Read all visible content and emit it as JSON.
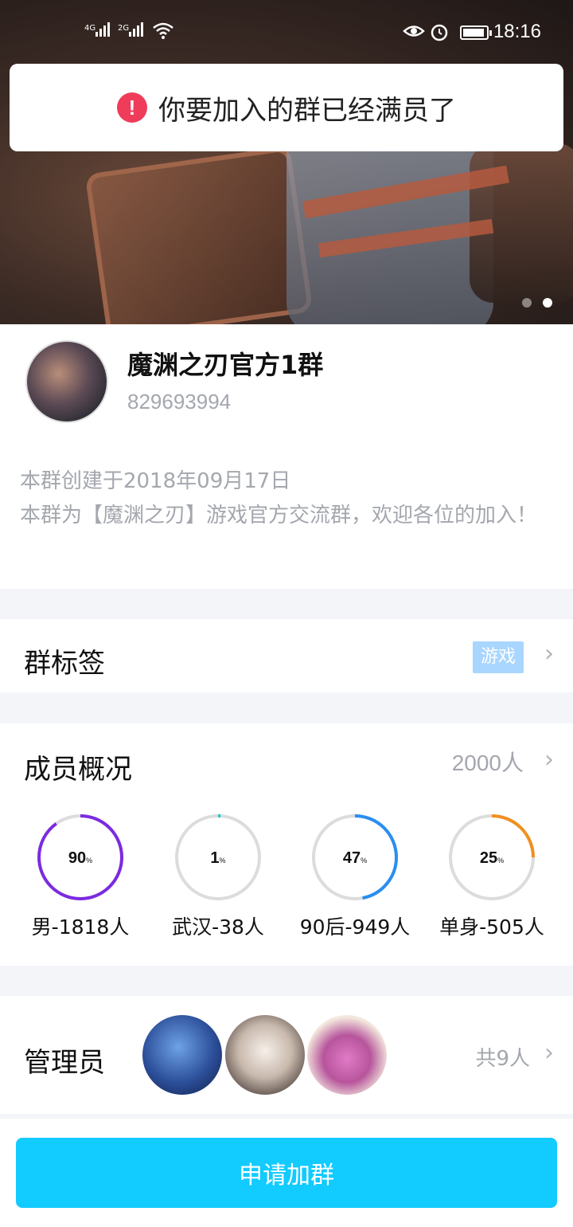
{
  "status_bar": {
    "sig1": "4G",
    "sig2": "2G",
    "time": "18:16",
    "icons": [
      "eye-icon",
      "alarm-icon",
      "wifi-icon",
      "battery-icon"
    ]
  },
  "toast": {
    "icon": "alert-icon",
    "message": "你要加入的群已经满员了"
  },
  "banner": {
    "slides": 2,
    "active_slide": 2
  },
  "group": {
    "name": "魔渊之刃官方1群",
    "id": "829693994",
    "created": "本群创建于2018年09月17日",
    "description": "本群为【魔渊之刃】游戏官方交流群，欢迎各位的加入！"
  },
  "tags_section": {
    "title": "群标签",
    "tag": "游戏"
  },
  "members_section": {
    "title": "成员概况",
    "count": "2000人",
    "stats": [
      {
        "pct": "90",
        "unit": "%",
        "label": "男-1818人",
        "value": 0.9,
        "color": "#7b2be0"
      },
      {
        "pct": "1",
        "unit": "%",
        "label": "武汉-38人",
        "value": 0.01,
        "color": "#2ec4c4"
      },
      {
        "pct": "47",
        "unit": "%",
        "label": "90后-949人",
        "value": 0.47,
        "color": "#2a8ef0"
      },
      {
        "pct": "25",
        "unit": "%",
        "label": "单身-505人",
        "value": 0.25,
        "color": "#f09020"
      }
    ]
  },
  "admins_section": {
    "title": "管理员",
    "count": "共9人"
  },
  "join_button": "申请加群",
  "colors": {
    "accent": "#12cbff",
    "alert": "#ef3c5a",
    "tag": "#a9d6ff"
  }
}
